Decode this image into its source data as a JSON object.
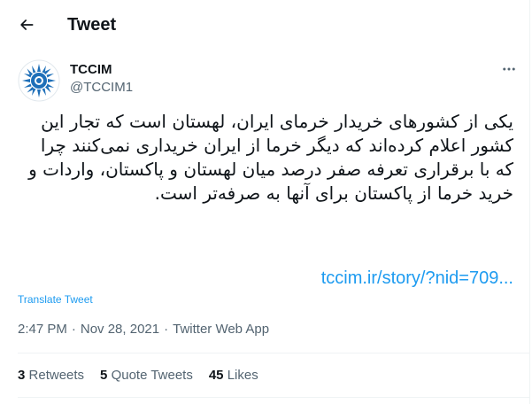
{
  "header": {
    "title": "Tweet"
  },
  "author": {
    "name": "TCCIM",
    "handle": "@TCCIM1"
  },
  "tweet": {
    "text": "یکی از کشورهای خریدار خرمای ایران، لهستان است که تجار این کشور اعلام کرده‌اند که دیگر خرما از ایران خریداری نمی‌کنند چرا که با برقراری تعرفه صفر درصد میان لهستان و پاکستان، واردات و خرید خرما از پاکستان برای آنها به صرفه‌تر است.",
    "link": "tccim.ir/story/?nid=709...",
    "translate_label": "Translate Tweet"
  },
  "meta": {
    "time": "2:47 PM",
    "separator1": "·",
    "date": "Nov 28, 2021",
    "separator2": "·",
    "source": "Twitter Web App"
  },
  "stats": {
    "retweets_count": "3",
    "retweets_label": "Retweets",
    "quotes_count": "5",
    "quotes_label": "Quote Tweets",
    "likes_count": "45",
    "likes_label": "Likes"
  },
  "icons": {
    "back": "arrow-left-icon",
    "more": "more-horizontal-icon",
    "avatar": "tccim-logo"
  },
  "colors": {
    "accent": "#1d9bf0",
    "secondary_text": "#536471",
    "divider": "#eff3f4",
    "logo_blue": "#1e6fb8"
  }
}
